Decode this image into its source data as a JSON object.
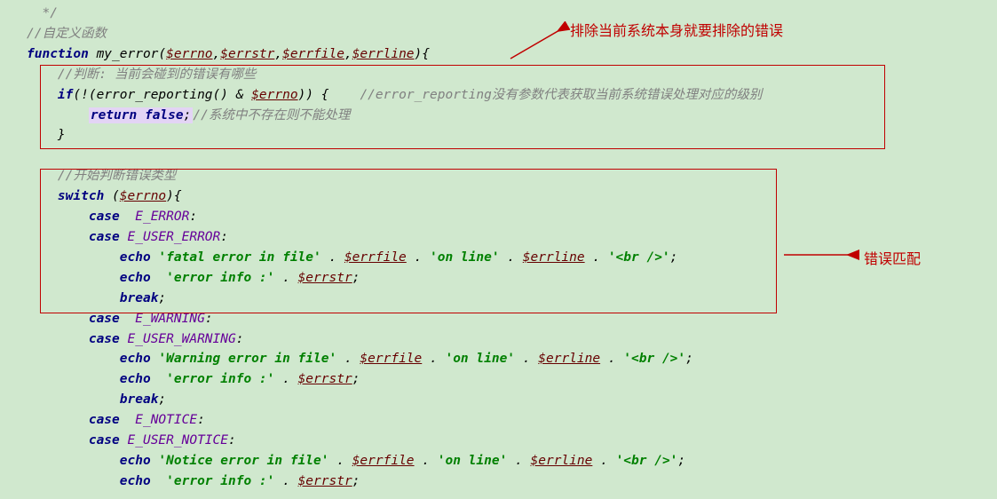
{
  "annot": {
    "a1": "排除当前系统本身就要排除的错误",
    "a2": "错误匹配"
  },
  "tokens": {
    "close_comment": "*/",
    "c_custom_fn": "//自定义函数",
    "kw_function": "function",
    "fn_name": "my_error",
    "var_errno": "$errno",
    "var_errstr": "$errstr",
    "var_errfile": "$errfile",
    "var_errline": "$errline",
    "c_judge": "//判断: 当前会碰到的错误有哪些",
    "kw_if": "if",
    "fn_error_reporting": "error_reporting",
    "c_error_reporting": "//error_reporting没有参数代表获取当前系统错误处理对应的级别",
    "kw_return": "return",
    "kw_false": "false",
    "c_no_handle": "//系统中不存在则不能处理",
    "c_type": "//开始判断错误类型",
    "kw_switch": "switch",
    "kw_case": "case",
    "E_ERROR": "E_ERROR",
    "E_USER_ERROR": "E_USER_ERROR",
    "E_WARNING": "E_WARNING",
    "E_USER_WARNING": "E_USER_WARNING",
    "E_NOTICE": "E_NOTICE",
    "E_USER_NOTICE": "E_USER_NOTICE",
    "kw_echo": "echo",
    "s_fatal": "'fatal error in file'",
    "s_warning": "'Warning error in file'",
    "s_notice": "'Notice error in file'",
    "s_online": "'on line'",
    "s_br": "'<br />'",
    "s_info": "'error info :'",
    "kw_break": "break"
  }
}
